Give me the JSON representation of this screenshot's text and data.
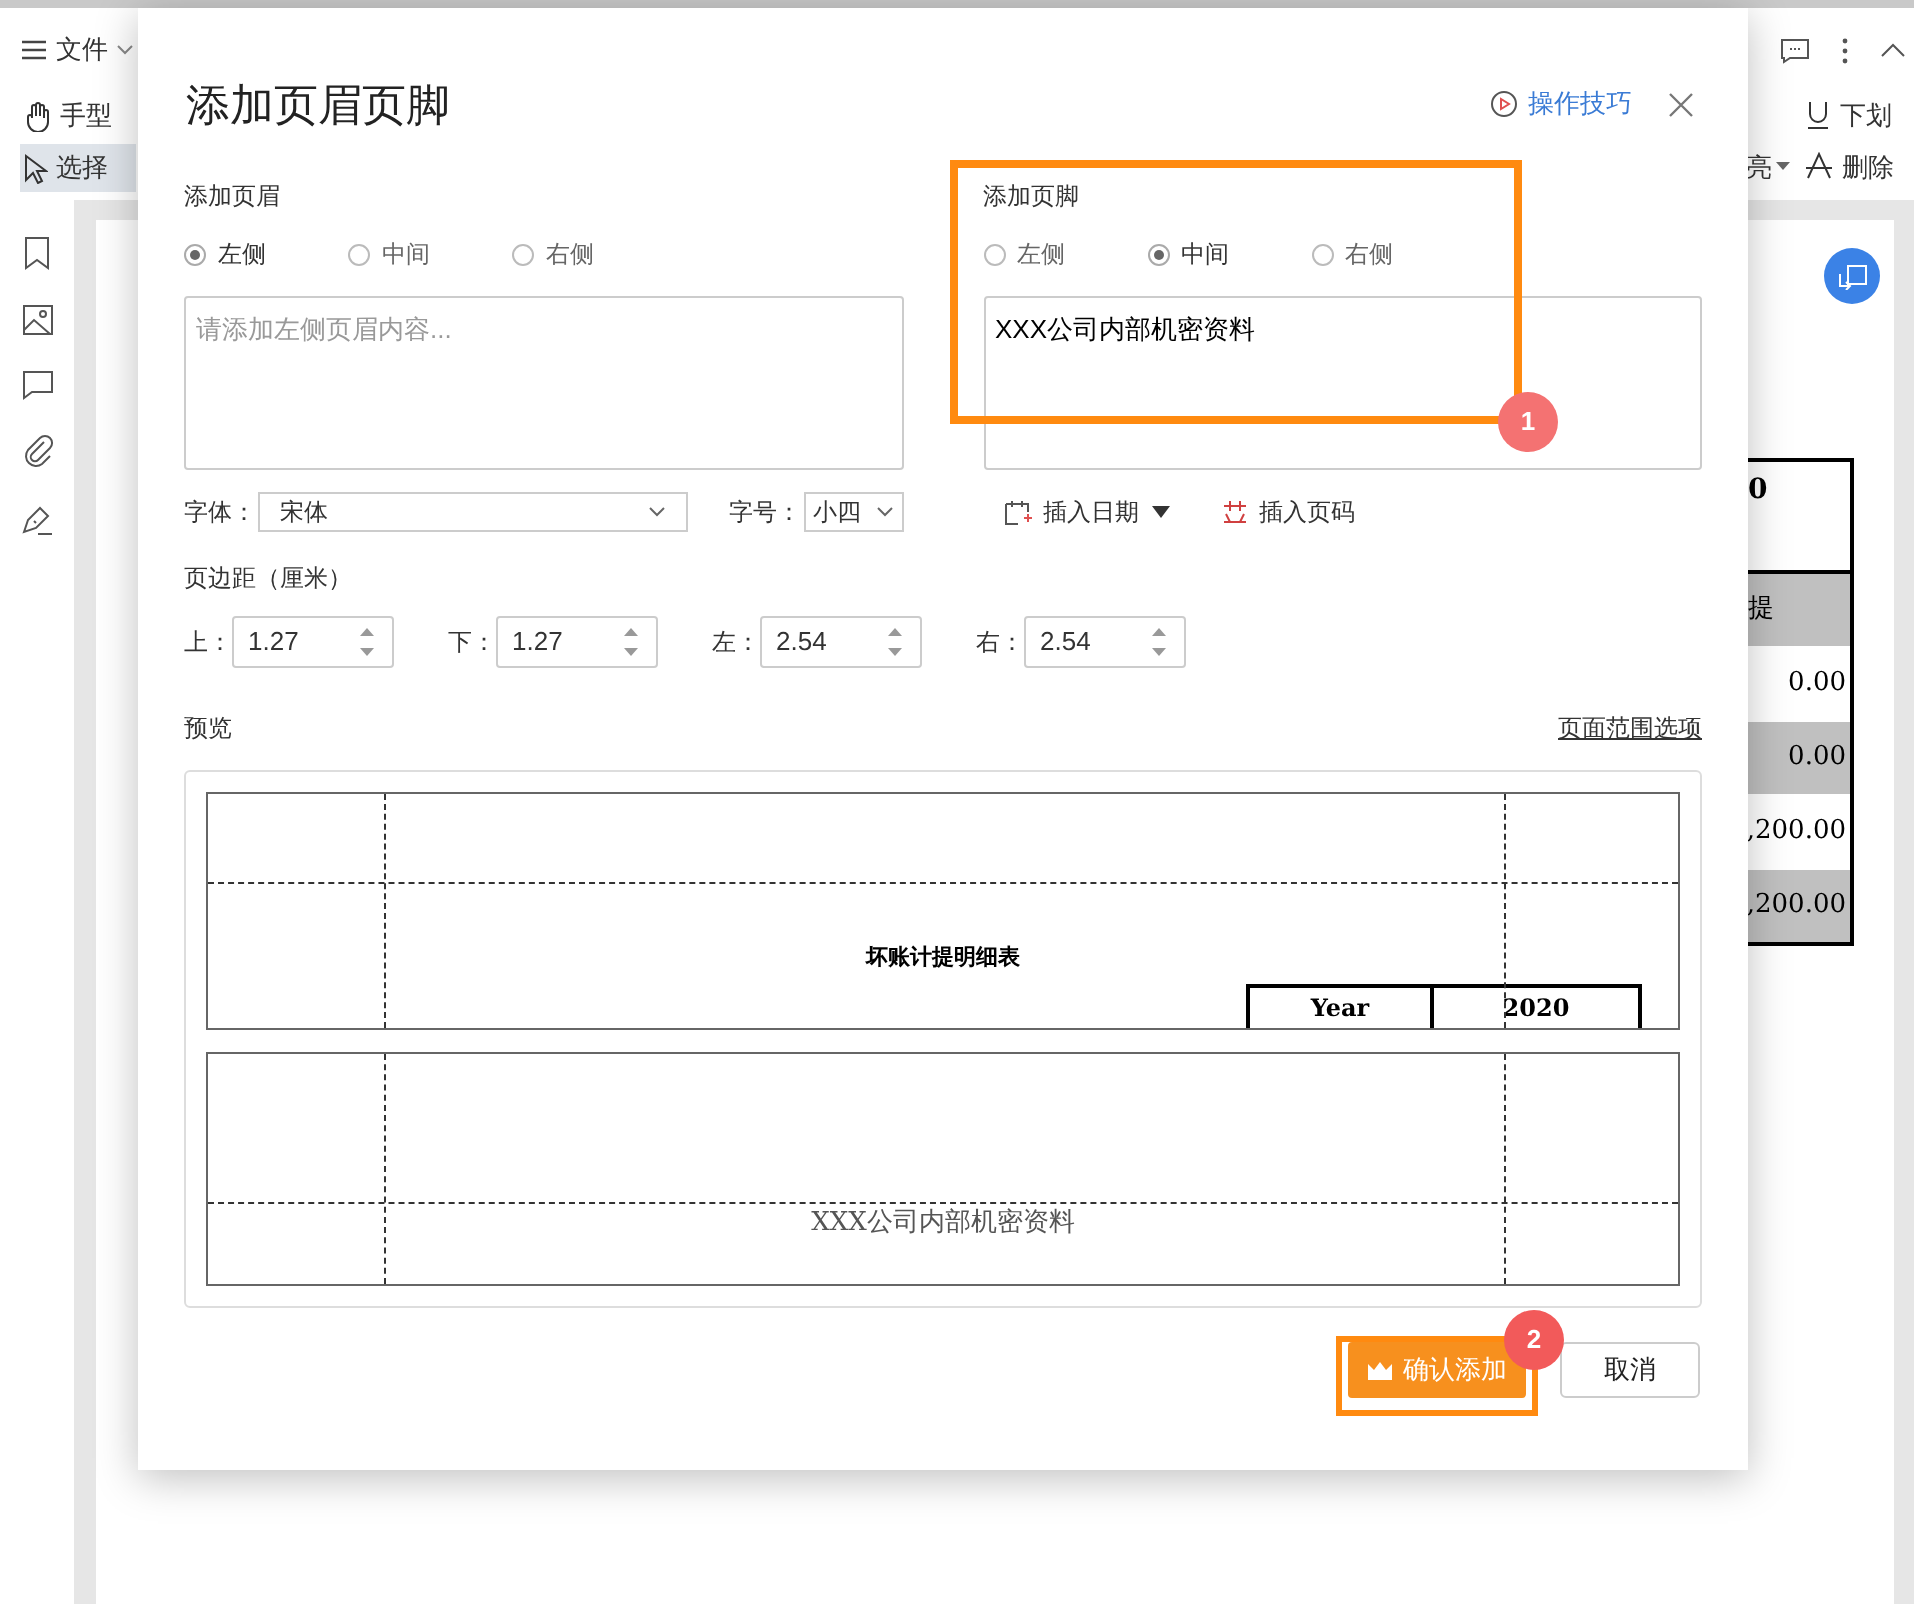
{
  "app": {
    "menu": "文件",
    "tools": [
      {
        "label": "手型",
        "selected": false
      },
      {
        "label": "选择",
        "selected": true
      }
    ],
    "right_tools": [
      {
        "label": "下划",
        "kind": "button"
      },
      {
        "label": "亮",
        "kind": "dropdown"
      },
      {
        "label": "删除",
        "kind": "button"
      }
    ]
  },
  "document": {
    "rows": [
      {
        "text": "0",
        "shaded": false
      },
      {
        "text": "提",
        "shaded": true
      },
      {
        "text": "0.00",
        "shaded": false
      },
      {
        "text": "0.00",
        "shaded": true
      },
      {
        "text": ",200.00",
        "shaded": false
      },
      {
        "text": ",200.00",
        "shaded": true
      }
    ]
  },
  "dialog": {
    "title": "添加页眉页脚",
    "help_link": "操作技巧",
    "header": {
      "label": "添加页眉",
      "options": [
        {
          "label": "左侧",
          "selected": true
        },
        {
          "label": "中间",
          "selected": false
        },
        {
          "label": "右侧",
          "selected": false
        }
      ],
      "placeholder": "请添加左侧页眉内容..."
    },
    "footer": {
      "label": "添加页脚",
      "options": [
        {
          "label": "左侧",
          "selected": false
        },
        {
          "label": "中间",
          "selected": true
        },
        {
          "label": "右侧",
          "selected": false
        }
      ],
      "value": "XXX公司内部机密资料"
    },
    "font": {
      "label": "字体：",
      "value": "宋体"
    },
    "size": {
      "label": "字号：",
      "value": "小四"
    },
    "insert_date": "插入日期",
    "insert_page": "插入页码",
    "margins": {
      "label": "页边距（厘米）",
      "fields": [
        {
          "label": "上：",
          "value": "1.27"
        },
        {
          "label": "下：",
          "value": "1.27"
        },
        {
          "label": "左：",
          "value": "2.54"
        },
        {
          "label": "右：",
          "value": "2.54"
        }
      ]
    },
    "preview": {
      "label": "预览",
      "range_link": "页面范围选项",
      "doc_title": "坏账计提明细表",
      "year_label": "Year",
      "year_value": "2020",
      "footer_text": "XXX公司内部机密资料"
    },
    "buttons": {
      "confirm": "确认添加",
      "cancel": "取消"
    }
  },
  "annotations": [
    {
      "number": "1"
    },
    {
      "number": "2"
    }
  ]
}
